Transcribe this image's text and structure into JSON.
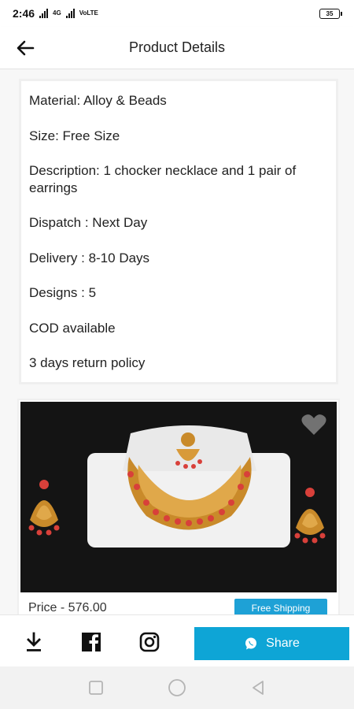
{
  "status_bar": {
    "time": "2:46",
    "net_labels": "VoLTE 4G",
    "battery": "35"
  },
  "app_bar": {
    "title": "Product Details"
  },
  "details": {
    "lines": [
      "Material: Alloy & Beads",
      "Size: Free Size",
      "Description: 1 chocker necklace and 1 pair of earrings",
      "Dispatch : Next Day",
      "Delivery : 8-10 Days",
      "Designs : 5",
      "COD available",
      "3 days return policy"
    ]
  },
  "product": {
    "image_icon": "necklace-earrings-photo",
    "price_label": "Price - 576.00",
    "badge": "Free Shipping"
  },
  "actions": {
    "download_icon": "download-icon",
    "facebook_icon": "facebook-icon",
    "instagram_icon": "instagram-icon",
    "share_label": "Share"
  },
  "colors": {
    "accent": "#0ea5d6",
    "badge": "#1ea1d6"
  }
}
